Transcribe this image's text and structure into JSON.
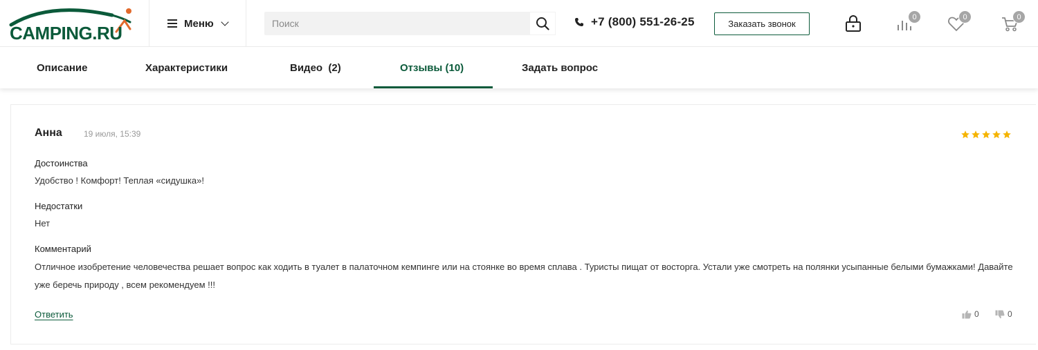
{
  "brand": {
    "logo_main": "CAMPING.",
    "logo_ru": "RU",
    "accent": "#0b5a3a",
    "logo_swoosh": "#e26a2c"
  },
  "header": {
    "menu_label": "Меню",
    "search_placeholder": "Поиск",
    "phone": "+7 (800) 551-26-25",
    "callback_label": "Заказать звонок",
    "compare_count": "0",
    "favorites_count": "0",
    "cart_count": "0"
  },
  "tabs": [
    {
      "label": "Описание"
    },
    {
      "label": "Характеристики"
    },
    {
      "label": "Видео  (2)"
    },
    {
      "label": "Отзывы (10)"
    },
    {
      "label": "Задать вопрос"
    }
  ],
  "review": {
    "author": "Анна",
    "date": "19 июля, 15:39",
    "rating": 5,
    "star_color": "#f5b400",
    "pros_title": "Достоинства",
    "pros_text": "Удобство ! Комфорт! Теплая «сидушка»!",
    "cons_title": "Недостатки",
    "cons_text": "Нет",
    "comment_title": "Комментарий",
    "comment_text": "Отличное изобретение человечества решает вопрос как ходить в туалет в палаточном кемпинге или на стоянке во время сплава . Туристы пищат от восторга. Устали уже смотреть на полянки усыпанные белыми бумажками! Давайте уже беречь природу , всем рекомендуем !!!",
    "reply_label": "Ответить",
    "likes": "0",
    "dislikes": "0"
  }
}
